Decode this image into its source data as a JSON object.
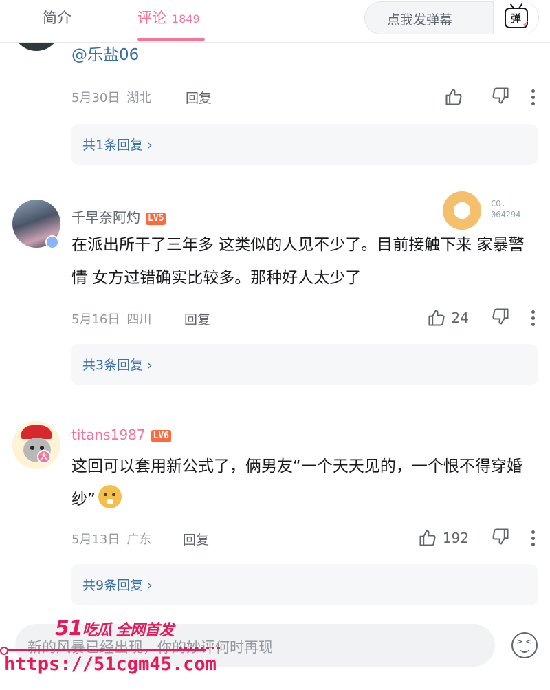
{
  "tabs": {
    "intro": "简介",
    "comments": "评论",
    "comment_count": "1849"
  },
  "danmaku": {
    "label": "点我发弹幕",
    "icon_text": "弹"
  },
  "comments": [
    {
      "mention": "@乐盐06",
      "date": "5月30日",
      "location": "湖北",
      "reply_label": "回复",
      "likes": "",
      "reply_summary": "共1条回复 ›"
    },
    {
      "username": "千早奈阿灼",
      "level": "LV5",
      "decoration_text": "CO. 064294",
      "text": "在派出所干了三年多 这类似的人见不少了。目前接触下来 家暴警情 女方过错确实比较多。那种好人太少了",
      "date": "5月16日",
      "location": "四川",
      "reply_label": "回复",
      "likes": "24",
      "reply_summary": "共3条回复 ›"
    },
    {
      "username": "titans1987",
      "level": "LV6",
      "avatar_badge": "大",
      "text": "这回可以套用新公式了，俩男友“一个天天见的，一个恨不得穿婚纱”",
      "date": "5月13日",
      "location": "广东",
      "reply_label": "回复",
      "likes": "192",
      "reply_summary": "共9条回复 ›"
    }
  ],
  "composer": {
    "placeholder": "新的风暴已经出现，你的妙评何时再现"
  },
  "watermark": {
    "brand_num": "51",
    "brand_text": "吃瓜 全网首发",
    "url": "https://51cgm45.com"
  },
  "colors": {
    "accent": "#fb7299",
    "link": "#3b6fa8",
    "level_badge": "#ff6a3d",
    "watermark": "#e8195a"
  }
}
